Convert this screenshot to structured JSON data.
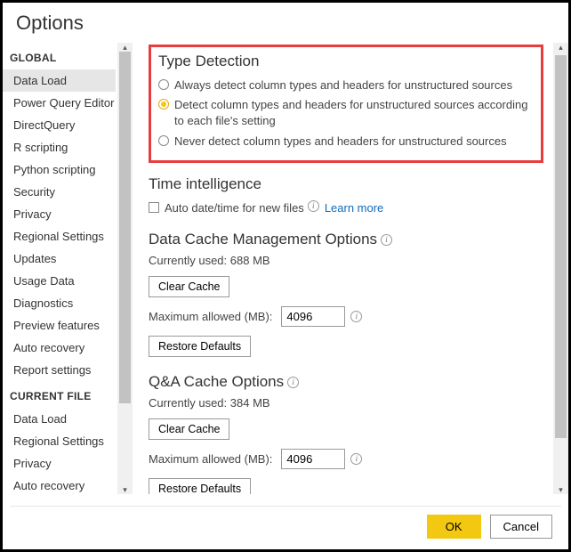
{
  "title": "Options",
  "sidebar": {
    "sections": [
      {
        "header": "GLOBAL",
        "items": [
          {
            "label": "Data Load",
            "selected": true
          },
          {
            "label": "Power Query Editor"
          },
          {
            "label": "DirectQuery"
          },
          {
            "label": "R scripting"
          },
          {
            "label": "Python scripting"
          },
          {
            "label": "Security"
          },
          {
            "label": "Privacy"
          },
          {
            "label": "Regional Settings"
          },
          {
            "label": "Updates"
          },
          {
            "label": "Usage Data"
          },
          {
            "label": "Diagnostics"
          },
          {
            "label": "Preview features"
          },
          {
            "label": "Auto recovery"
          },
          {
            "label": "Report settings"
          }
        ]
      },
      {
        "header": "CURRENT FILE",
        "items": [
          {
            "label": "Data Load"
          },
          {
            "label": "Regional Settings"
          },
          {
            "label": "Privacy"
          },
          {
            "label": "Auto recovery"
          }
        ]
      }
    ]
  },
  "typeDetection": {
    "title": "Type Detection",
    "options": [
      {
        "label": "Always detect column types and headers for unstructured sources",
        "selected": false
      },
      {
        "label": "Detect column types and headers for unstructured sources according to each file's setting",
        "selected": true
      },
      {
        "label": "Never detect column types and headers for unstructured sources",
        "selected": false
      }
    ]
  },
  "timeIntelligence": {
    "title": "Time intelligence",
    "checkboxLabel": "Auto date/time for new files",
    "learnMore": "Learn more"
  },
  "dataCache": {
    "title": "Data Cache Management Options",
    "currentlyUsed": "Currently used: 688 MB",
    "clearCache": "Clear Cache",
    "maxLabel": "Maximum allowed (MB):",
    "maxValue": "4096",
    "restore": "Restore Defaults"
  },
  "qaCache": {
    "title": "Q&A Cache Options",
    "currentlyUsed": "Currently used: 384 MB",
    "clearCache": "Clear Cache",
    "maxLabel": "Maximum allowed (MB):",
    "maxValue": "4096",
    "restore": "Restore Defaults"
  },
  "footer": {
    "ok": "OK",
    "cancel": "Cancel"
  }
}
